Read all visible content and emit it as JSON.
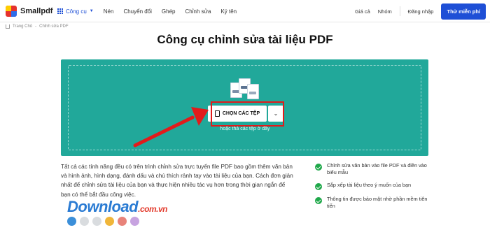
{
  "brand": {
    "name": "Smallpdf"
  },
  "nav": {
    "tools_label": "Công cụ",
    "items": [
      "Nén",
      "Chuyển đổi",
      "Ghép",
      "Chỉnh sửa",
      "Ký tên"
    ]
  },
  "right_nav": {
    "pricing": "Giá cả",
    "teams": "Nhóm",
    "login": "Đăng nhập",
    "free_trial": "Thử miễn phí"
  },
  "breadcrumb": {
    "home": "Trang Chủ",
    "separator": "-",
    "current": "Chỉnh sửa PDF"
  },
  "page_title": "Công cụ chỉnh sửa tài liệu PDF",
  "dropzone": {
    "choose_button": "CHỌN CÁC TỆP",
    "hint": "hoặc thả các tệp ở đây"
  },
  "description": "Tất cả các tính năng đều có trên trình chỉnh sửa trực tuyến file PDF bao gồm thêm văn bản và hình ảnh, hình dạng, đánh dấu và chú thích rảnh tay vào tài liệu của bạn. Cách đơn giản nhất để chỉnh sửa tài liệu của bạn và thực hiện nhiều tác vụ hơn trong thời gian ngắn để bạn có thể bắt đầu công việc.",
  "features": [
    "Chỉnh sửa văn bản vào file PDF và điền vào biểu mẫu",
    "Sắp xếp tài liệu theo ý muốn của bạn",
    "Thông tin được bảo mật nhờ phần mềm tiên tiến"
  ],
  "watermark": {
    "text": "Download",
    "domain": ".com.vn"
  },
  "colors": {
    "accent": "#1e4fd6",
    "dropzone": "#21a89a",
    "highlight": "#e21b1b",
    "check": "#1fa84a",
    "dots": [
      "#3b8fd9",
      "#d9dcdf",
      "#d9dcdf",
      "#f0b63a",
      "#e8837a",
      "#c7a3e0"
    ]
  }
}
